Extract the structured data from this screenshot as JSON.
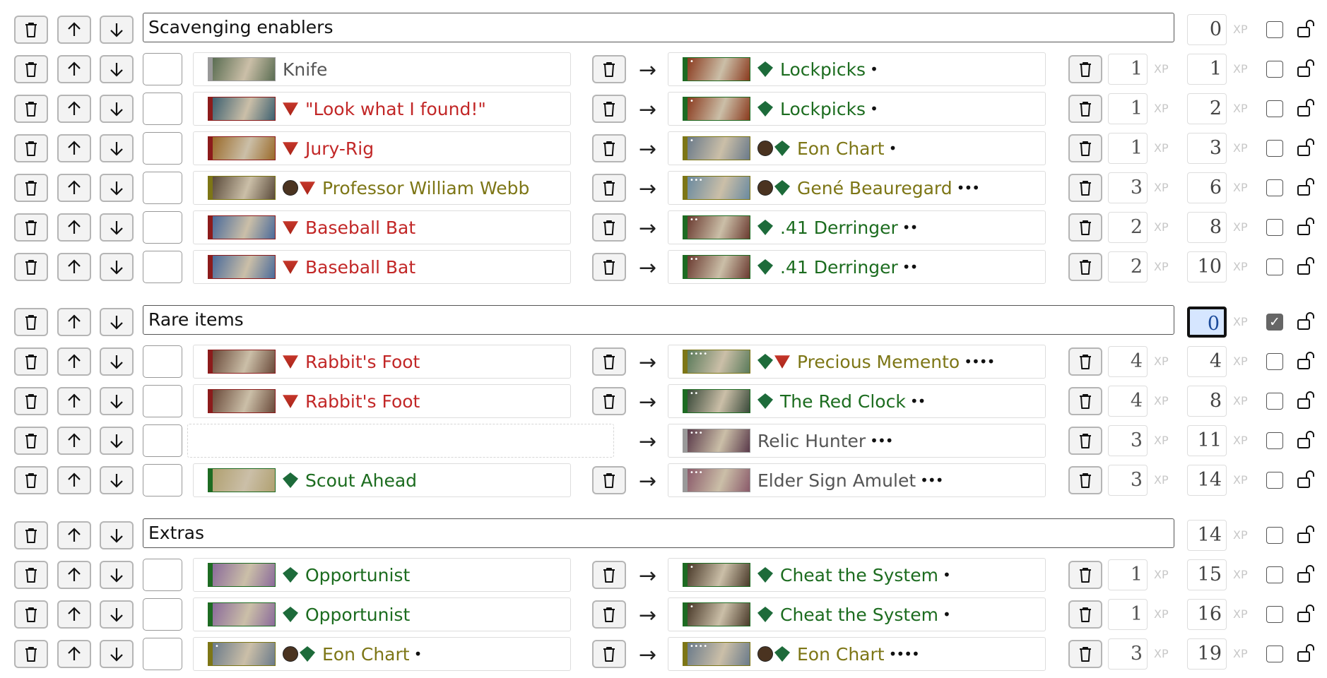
{
  "groups": [
    {
      "title": "Scavenging enablers",
      "total": "0",
      "checked": false,
      "rows": [
        {
          "from": {
            "name": "Knife",
            "cls": "n",
            "icons": [],
            "dots": "",
            "thumb_color": "#5a6d52",
            "pips": ""
          },
          "to": {
            "name": "Lockpicks",
            "cls": "g",
            "icons": [
              "rogue-icon"
            ],
            "dots": "•",
            "thumb_color": "#8a3a1e",
            "pips": "•"
          },
          "cost": "1",
          "total": "1"
        },
        {
          "from": {
            "name": "\"Look what I found!\"",
            "cls": "r",
            "icons": [
              "survivor-icon"
            ],
            "dots": "",
            "thumb_color": "#3d6070",
            "pips": ""
          },
          "to": {
            "name": "Lockpicks",
            "cls": "g",
            "icons": [
              "rogue-icon"
            ],
            "dots": "•",
            "thumb_color": "#8a3a1e",
            "pips": "•"
          },
          "cost": "1",
          "total": "2"
        },
        {
          "from": {
            "name": "Jury-Rig",
            "cls": "r",
            "icons": [
              "survivor-icon"
            ],
            "dots": "",
            "thumb_color": "#9a6a2a",
            "pips": ""
          },
          "to": {
            "name": "Eon Chart",
            "cls": "o",
            "icons": [
              "resource-icon",
              "rogue-icon"
            ],
            "dots": "•",
            "thumb_color": "#6a7a8a",
            "pips": "•"
          },
          "cost": "1",
          "total": "3"
        },
        {
          "from": {
            "name": "Professor William Webb",
            "cls": "o",
            "icons": [
              "resource-icon",
              "survivor-icon"
            ],
            "dots": "",
            "thumb_color": "#5a4a3a",
            "pips": ""
          },
          "to": {
            "name": "Gené Beauregard",
            "cls": "o",
            "icons": [
              "resource-icon",
              "rogue-icon"
            ],
            "dots": "•••",
            "thumb_color": "#6a8aa0",
            "pips": "•••"
          },
          "cost": "3",
          "total": "6"
        },
        {
          "from": {
            "name": "Baseball Bat",
            "cls": "r",
            "icons": [
              "survivor-icon"
            ],
            "dots": "",
            "thumb_color": "#4a6a9a",
            "pips": ""
          },
          "to": {
            "name": ".41 Derringer",
            "cls": "g",
            "icons": [
              "rogue-icon"
            ],
            "dots": "••",
            "thumb_color": "#6a3a30",
            "pips": "••"
          },
          "cost": "2",
          "total": "8"
        },
        {
          "from": {
            "name": "Baseball Bat",
            "cls": "r",
            "icons": [
              "survivor-icon"
            ],
            "dots": "",
            "thumb_color": "#4a6a9a",
            "pips": ""
          },
          "to": {
            "name": ".41 Derringer",
            "cls": "g",
            "icons": [
              "rogue-icon"
            ],
            "dots": "••",
            "thumb_color": "#6a3a30",
            "pips": "••"
          },
          "cost": "2",
          "total": "10"
        }
      ]
    },
    {
      "title": "Rare items",
      "total": "0",
      "checked": true,
      "rows": [
        {
          "from": {
            "name": "Rabbit's Foot",
            "cls": "r",
            "icons": [
              "survivor-icon"
            ],
            "dots": "",
            "thumb_color": "#6a4a3a",
            "pips": ""
          },
          "to": {
            "name": "Precious Memento",
            "cls": "o",
            "icons": [
              "rogue-icon",
              "survivor-icon"
            ],
            "dots": "••••",
            "thumb_color": "#5a7a5a",
            "pips": "••••"
          },
          "cost": "4",
          "total": "4"
        },
        {
          "from": {
            "name": "Rabbit's Foot",
            "cls": "r",
            "icons": [
              "survivor-icon"
            ],
            "dots": "",
            "thumb_color": "#6a4a3a",
            "pips": ""
          },
          "to": {
            "name": "The Red Clock",
            "cls": "g",
            "icons": [
              "rogue-icon"
            ],
            "dots": "••",
            "thumb_color": "#3a4a3a",
            "pips": "••"
          },
          "cost": "4",
          "total": "8"
        },
        {
          "from": null,
          "to": {
            "name": "Relic Hunter",
            "cls": "n",
            "icons": [],
            "dots": "•••",
            "thumb_color": "#5a3a4a",
            "pips": "•••"
          },
          "cost": "3",
          "total": "11"
        },
        {
          "from": {
            "name": "Scout Ahead",
            "cls": "g",
            "icons": [
              "rogue-icon"
            ],
            "dots": "",
            "thumb_color": "#b0a070",
            "pips": ""
          },
          "to": {
            "name": "Elder Sign Amulet",
            "cls": "n",
            "icons": [],
            "dots": "•••",
            "thumb_color": "#8a5a6a",
            "pips": "•••"
          },
          "cost": "3",
          "total": "14"
        }
      ]
    },
    {
      "title": "Extras",
      "total": "14",
      "checked": false,
      "rows": [
        {
          "from": {
            "name": "Opportunist",
            "cls": "g",
            "icons": [
              "rogue-icon"
            ],
            "dots": "",
            "thumb_color": "#8a6a9a",
            "pips": ""
          },
          "to": {
            "name": "Cheat the System",
            "cls": "g",
            "icons": [
              "rogue-icon"
            ],
            "dots": "•",
            "thumb_color": "#4a3a2a",
            "pips": "•"
          },
          "cost": "1",
          "total": "15"
        },
        {
          "from": {
            "name": "Opportunist",
            "cls": "g",
            "icons": [
              "rogue-icon"
            ],
            "dots": "",
            "thumb_color": "#8a6a9a",
            "pips": ""
          },
          "to": {
            "name": "Cheat the System",
            "cls": "g",
            "icons": [
              "rogue-icon"
            ],
            "dots": "•",
            "thumb_color": "#4a3a2a",
            "pips": "•"
          },
          "cost": "1",
          "total": "16"
        },
        {
          "from": {
            "name": "Eon Chart",
            "cls": "o",
            "icons": [
              "resource-icon",
              "rogue-icon"
            ],
            "dots": "•",
            "thumb_color": "#6a7a8a",
            "pips": "•"
          },
          "to": {
            "name": "Eon Chart",
            "cls": "o",
            "icons": [
              "resource-icon",
              "rogue-icon"
            ],
            "dots": "••••",
            "thumb_color": "#6a7a8a",
            "pips": "••••"
          },
          "cost": "3",
          "total": "19"
        }
      ]
    }
  ],
  "labels": {
    "xp": "XP",
    "arrow": "→"
  }
}
